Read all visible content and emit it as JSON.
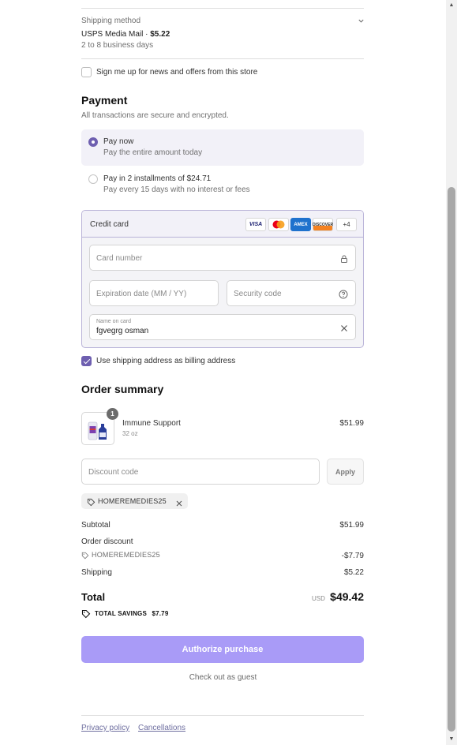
{
  "shipping": {
    "label": "Shipping method",
    "method_name": "USPS Media Mail · ",
    "price": "$5.22",
    "days": "2 to 8 business days"
  },
  "newsletter": {
    "label": "Sign me up for news and offers from this store",
    "checked": false
  },
  "payment": {
    "title": "Payment",
    "subtitle": "All transactions are secure and encrypted.",
    "options": [
      {
        "title": "Pay now",
        "sub": "Pay the entire amount today",
        "selected": true
      },
      {
        "title": "Pay in 2 installments of $24.71",
        "sub": "Pay every 15 days with no interest or fees",
        "selected": false
      }
    ],
    "credit_card": {
      "title": "Credit card",
      "brands": [
        "VISA",
        "Mastercard",
        "AMEX",
        "DISCOVER",
        "+4"
      ],
      "card_number_placeholder": "Card number",
      "expiration_placeholder": "Expiration date (MM / YY)",
      "security_placeholder": "Security code",
      "name_label": "Name on card",
      "name_value": "fgvegrg osman"
    },
    "billing_same": {
      "label": "Use shipping address as billing address",
      "checked": true
    }
  },
  "order": {
    "title": "Order summary",
    "item": {
      "name": "Immune Support",
      "size": "32 oz",
      "price": "$51.99",
      "qty": "1"
    },
    "discount_placeholder": "Discount code",
    "apply_label": "Apply",
    "chip": "HOMEREMEDIES25",
    "subtotal_label": "Subtotal",
    "subtotal": "$51.99",
    "order_discount_label": "Order discount",
    "discount_code": "HOMEREMEDIES25",
    "discount_amount": "-$7.79",
    "shipping_label": "Shipping",
    "shipping": "$5.22",
    "total_label": "Total",
    "currency": "USD",
    "total": "$49.42",
    "savings_label": "TOTAL SAVINGS",
    "savings": "$7.79"
  },
  "actions": {
    "authorize": "Authorize purchase",
    "guest": "Check out as guest"
  },
  "footer": {
    "privacy": "Privacy policy",
    "cancellations": "Cancellations"
  },
  "colors": {
    "accent": "#6e5fb0",
    "button": "#a99bf7",
    "link": "#6f6fa0"
  }
}
